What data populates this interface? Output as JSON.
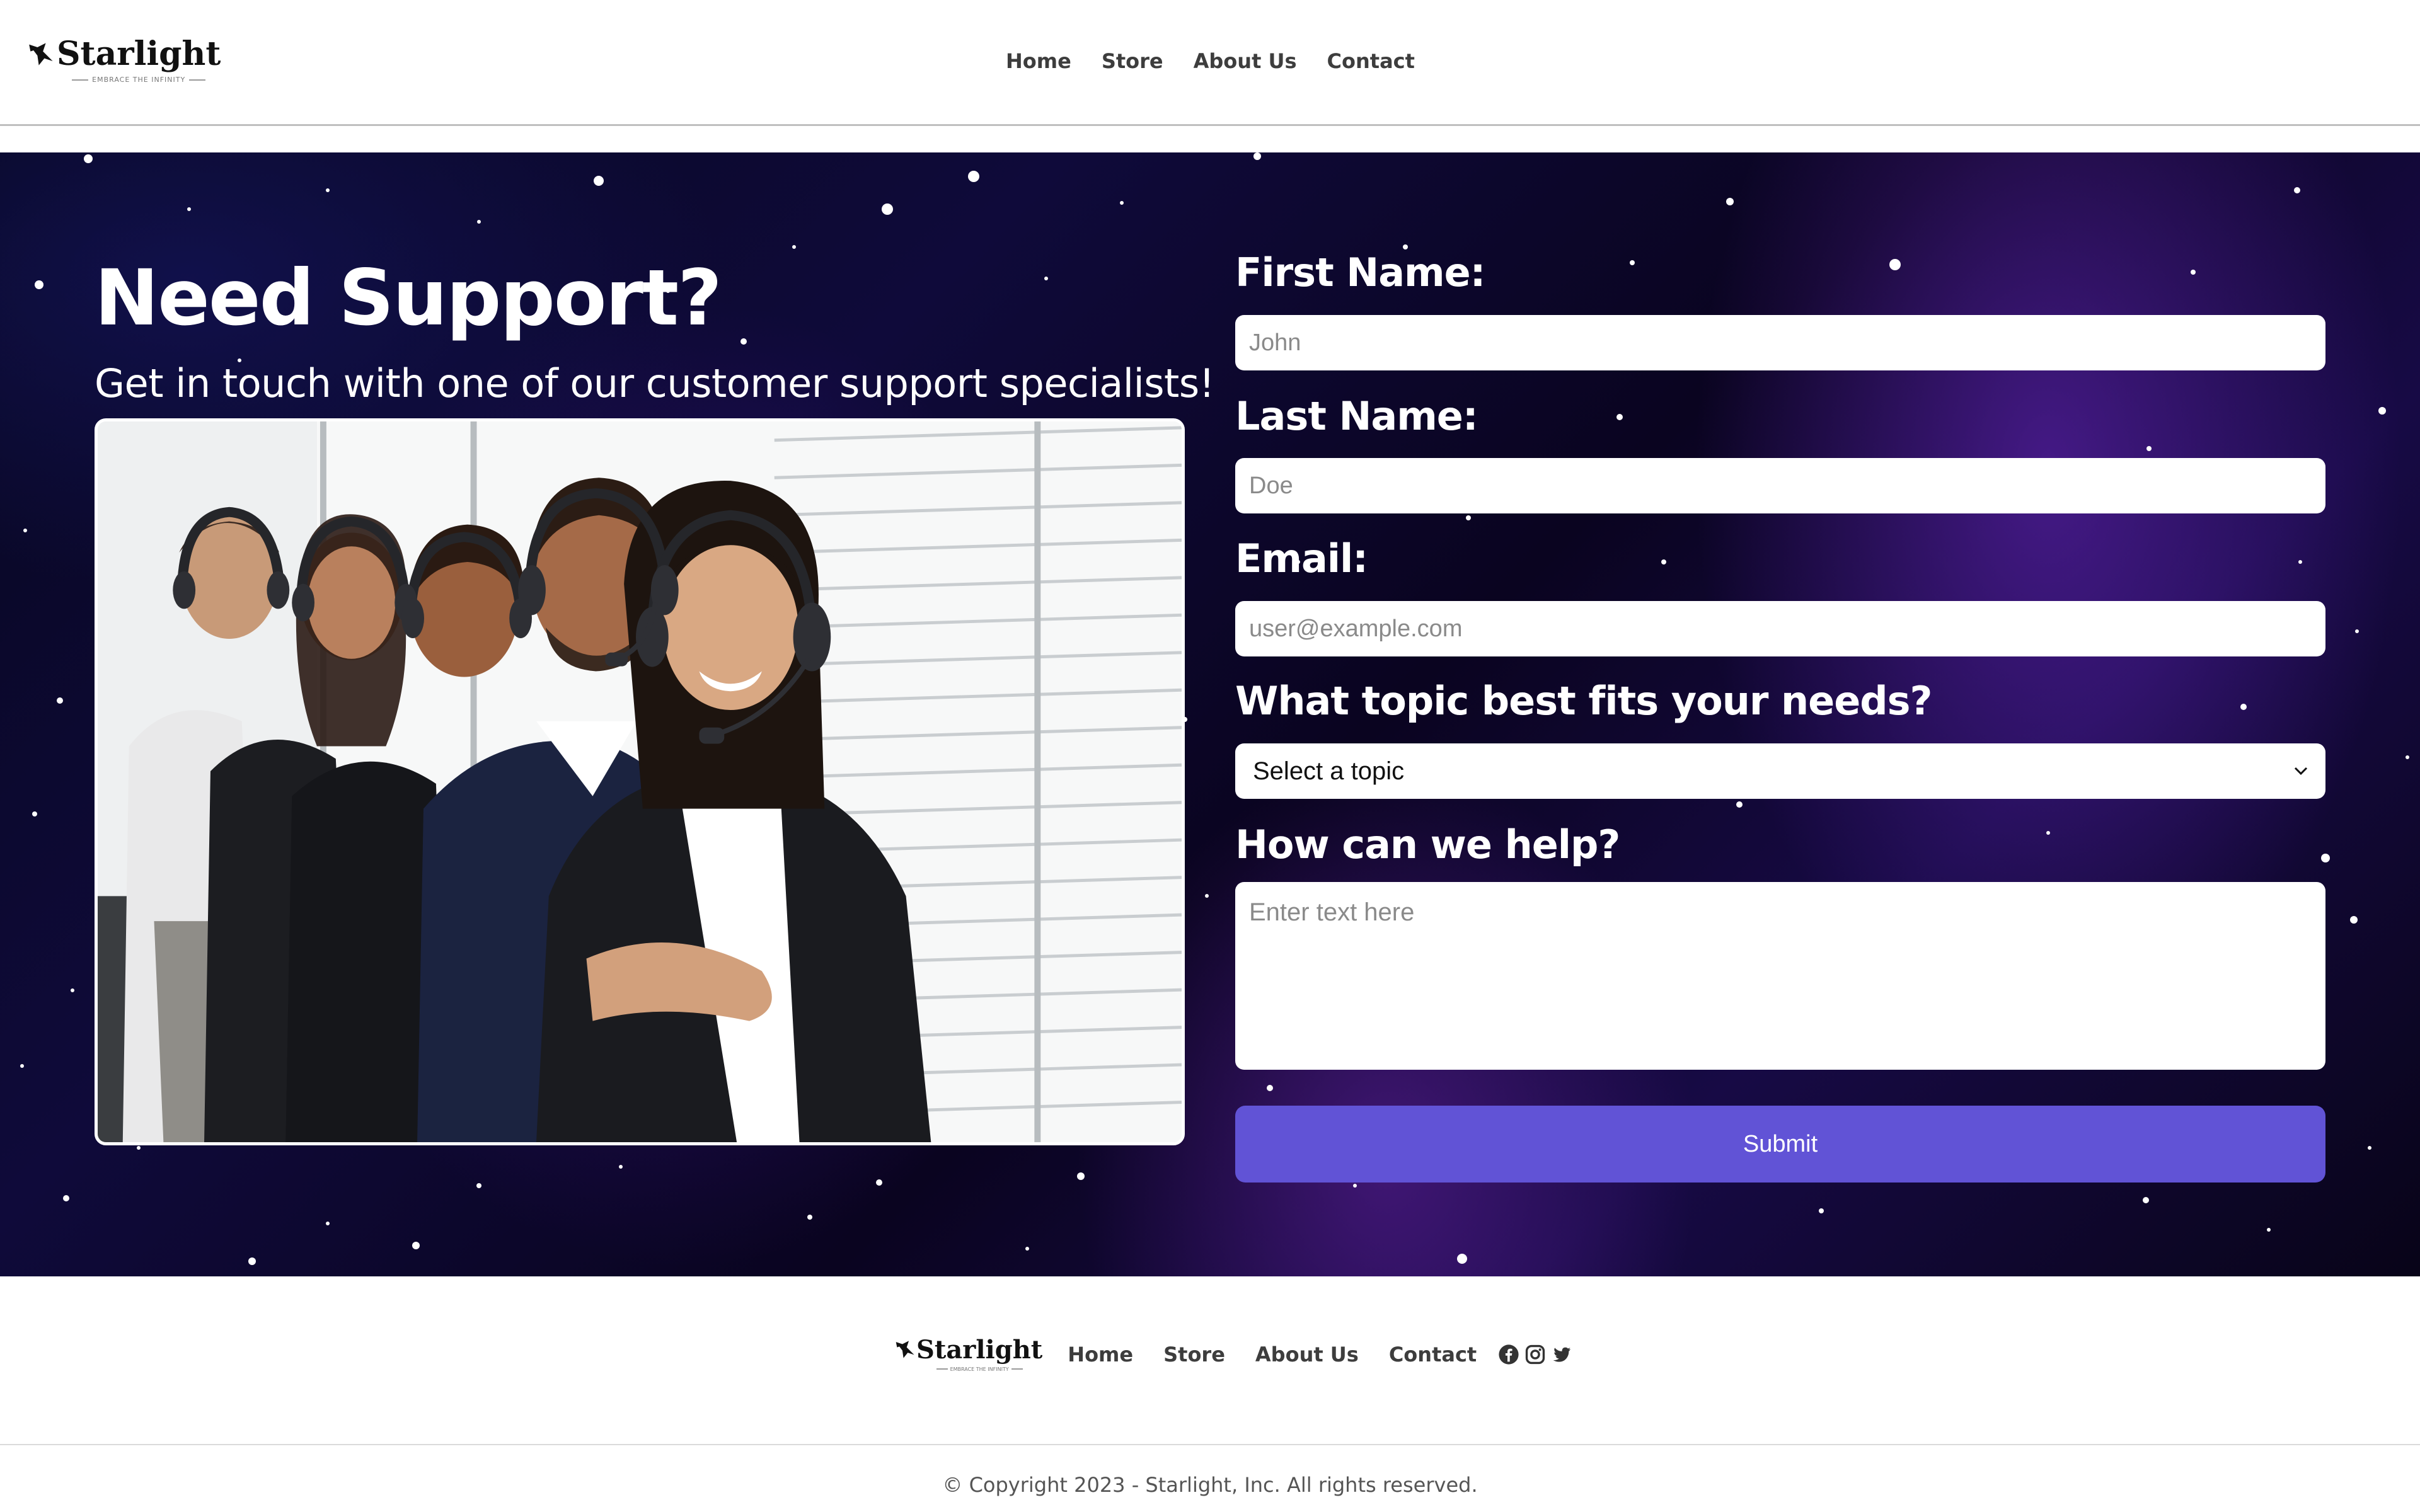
{
  "brand": {
    "name": "Starlight",
    "tagline": "EMBRACE THE INFINITY"
  },
  "nav": {
    "items": [
      "Home",
      "Store",
      "About Us",
      "Contact"
    ]
  },
  "hero": {
    "title": "Need Support?",
    "subtitle": "Get in touch with one of our customer support specialists!"
  },
  "form": {
    "first_name": {
      "label": "First Name:",
      "placeholder": "John"
    },
    "last_name": {
      "label": "Last Name:",
      "placeholder": "Doe"
    },
    "email": {
      "label": "Email:",
      "placeholder": "user@example.com"
    },
    "topic": {
      "label": "What topic best fits your needs?",
      "selected": "Select a topic"
    },
    "message": {
      "label": "How can we help?",
      "placeholder": "Enter text here"
    },
    "submit_label": "Submit"
  },
  "footer": {
    "nav": [
      "Home",
      "Store",
      "About Us",
      "Contact"
    ],
    "social": [
      "facebook-icon",
      "instagram-icon",
      "twitter-icon"
    ],
    "copyright": "© Copyright 2023 - Starlight, Inc. All rights reserved."
  },
  "colors": {
    "accent": "#6153d6",
    "hero_background": "#0b0828",
    "text_dark": "#3d3d3d"
  }
}
